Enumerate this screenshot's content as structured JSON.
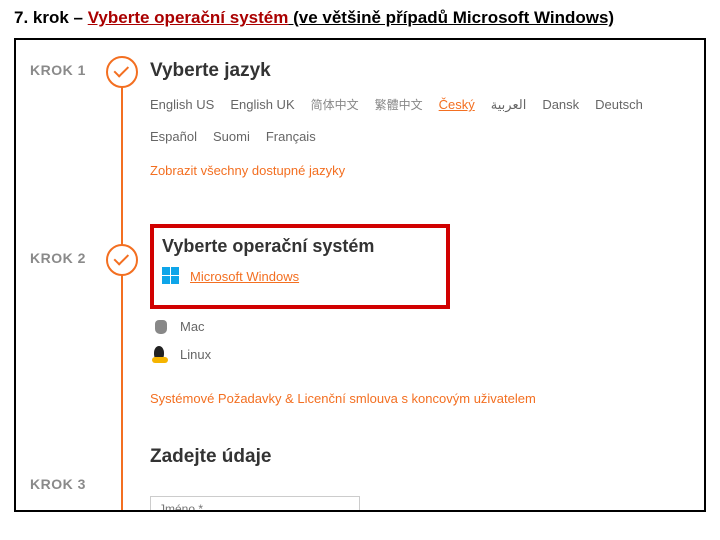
{
  "title": {
    "prefix": "7. krok – ",
    "highlight": "Vyberte operační systém",
    "suffix": " (ve většině případů Microsoft Windows)"
  },
  "steps": {
    "s1": "KROK 1",
    "s2": "KROK 2",
    "s3": "KROK 3"
  },
  "section1": {
    "heading": "Vyberte jazyk",
    "langs": {
      "l0": "English US",
      "l1": "English UK",
      "l2": "简体中文",
      "l3": "繁體中文",
      "l4": "Český",
      "l5": "العربية",
      "l6": "Dansk",
      "l7": "Deutsch",
      "l8": "Español",
      "l9": "Suomi",
      "l10": "Français"
    },
    "show_all": "Zobrazit všechny dostupné jazyky"
  },
  "section2": {
    "heading": "Vyberte operační systém",
    "os": {
      "win": "Microsoft Windows",
      "mac": "Mac",
      "linux": "Linux"
    },
    "req_link": "Systémové Požadavky & Licenční smlouva s koncovým uživatelem"
  },
  "section3": {
    "heading": "Zadejte údaje",
    "input_placeholder": "Jméno *"
  }
}
